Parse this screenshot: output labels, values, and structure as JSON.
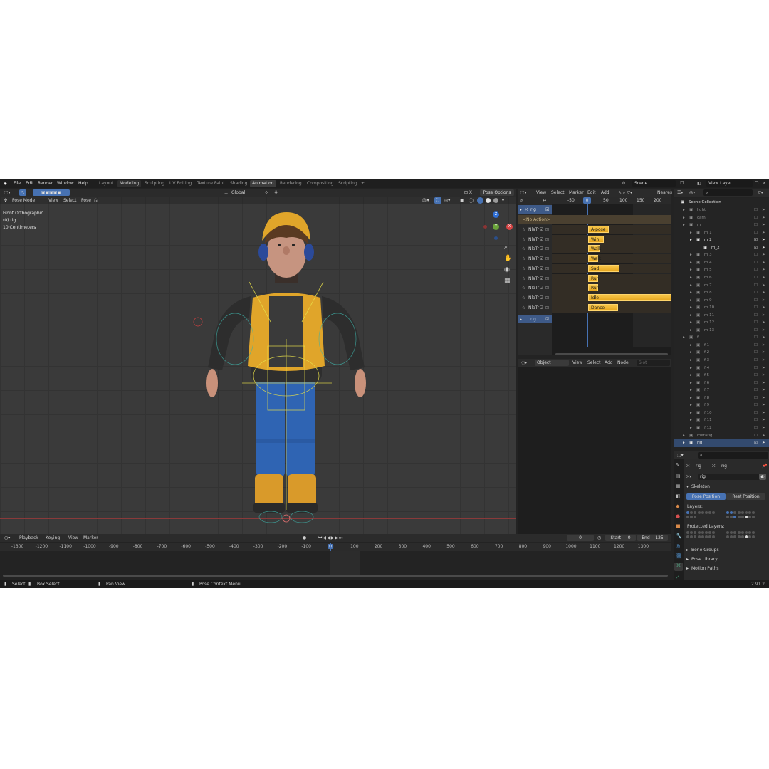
{
  "menu": [
    "File",
    "Edit",
    "Render",
    "Window",
    "Help"
  ],
  "workspaces": [
    {
      "label": "Layout",
      "active": false
    },
    {
      "label": "Modeling",
      "active": false
    },
    {
      "label": "Sculpting",
      "active": false
    },
    {
      "label": "UV Editing",
      "active": false
    },
    {
      "label": "Texture Paint",
      "active": false
    },
    {
      "label": "Shading",
      "active": false
    },
    {
      "label": "Animation",
      "active": true
    },
    {
      "label": "Rendering",
      "active": false
    },
    {
      "label": "Compositing",
      "active": false
    },
    {
      "label": "Scripting",
      "active": false
    }
  ],
  "add_tab": "+",
  "scene_label": "Scene",
  "view_layer_label": "View Layer",
  "viewport": {
    "mode": "Pose Mode",
    "menus": [
      "View",
      "Select",
      "Pose"
    ],
    "orientation": "Global",
    "pose_options": "Pose Options",
    "info": [
      "Front Orthographic",
      "(0) rig",
      "10 Centimeters"
    ],
    "gizmo": {
      "z": "Z",
      "y": "Y",
      "x": "X"
    }
  },
  "nla": {
    "menus": [
      "View",
      "Select",
      "Marker",
      "Edit",
      "Add"
    ],
    "snap": "Neares",
    "ruler": [
      "-50",
      "0",
      "50",
      "100",
      "150",
      "200"
    ],
    "object": "rig",
    "action": "<No Action>",
    "track_label": "NlaTr",
    "strips": [
      {
        "name": "A-pose",
        "width": 0.25
      },
      {
        "name": "Win",
        "width": 0.19
      },
      {
        "name": "Walk (f",
        "width": 0.14
      },
      {
        "name": "Walk",
        "width": 0.1
      },
      {
        "name": "Sad",
        "width": 0.38
      },
      {
        "name": "Run",
        "width": 0.08
      },
      {
        "name": "Run",
        "width": 0.08
      },
      {
        "name": "Idle",
        "width": 1.0
      },
      {
        "name": "Dance",
        "width": 0.36
      }
    ],
    "second_object": "rig"
  },
  "node": {
    "object_mode": "Object",
    "menus": [
      "View",
      "Select",
      "Add",
      "Node"
    ],
    "slot": "Slot"
  },
  "outliner": {
    "title": "Scene Collection",
    "rows": [
      {
        "label": "light",
        "bright": false,
        "indent": 1
      },
      {
        "label": "cam",
        "bright": false,
        "indent": 1
      },
      {
        "label": "m",
        "bright": false,
        "indent": 1
      },
      {
        "label": "m 1",
        "bright": false,
        "indent": 2
      },
      {
        "label": "m 2",
        "bright": true,
        "indent": 2
      },
      {
        "label": "m_2",
        "bright": true,
        "indent": 3
      },
      {
        "label": "m 3",
        "bright": false,
        "indent": 2
      },
      {
        "label": "m 4",
        "bright": false,
        "indent": 2
      },
      {
        "label": "m 5",
        "bright": false,
        "indent": 2
      },
      {
        "label": "m 6",
        "bright": false,
        "indent": 2
      },
      {
        "label": "m 7",
        "bright": false,
        "indent": 2
      },
      {
        "label": "m 8",
        "bright": false,
        "indent": 2
      },
      {
        "label": "m 9",
        "bright": false,
        "indent": 2
      },
      {
        "label": "m 10",
        "bright": false,
        "indent": 2
      },
      {
        "label": "m 11",
        "bright": false,
        "indent": 2
      },
      {
        "label": "m 12",
        "bright": false,
        "indent": 2
      },
      {
        "label": "m 13",
        "bright": false,
        "indent": 2
      },
      {
        "label": "f",
        "bright": false,
        "indent": 1
      },
      {
        "label": "f 1",
        "bright": false,
        "indent": 2
      },
      {
        "label": "f 2",
        "bright": false,
        "indent": 2
      },
      {
        "label": "f 3",
        "bright": false,
        "indent": 2
      },
      {
        "label": "f 4",
        "bright": false,
        "indent": 2
      },
      {
        "label": "f 5",
        "bright": false,
        "indent": 2
      },
      {
        "label": "f 6",
        "bright": false,
        "indent": 2
      },
      {
        "label": "f 7",
        "bright": false,
        "indent": 2
      },
      {
        "label": "f 8",
        "bright": false,
        "indent": 2
      },
      {
        "label": "f 9",
        "bright": false,
        "indent": 2
      },
      {
        "label": "f 10",
        "bright": false,
        "indent": 2
      },
      {
        "label": "f 11",
        "bright": false,
        "indent": 2
      },
      {
        "label": "f 12",
        "bright": false,
        "indent": 2
      },
      {
        "label": "metarig",
        "bright": false,
        "indent": 1
      },
      {
        "label": "rig",
        "bright": true,
        "indent": 1
      }
    ]
  },
  "properties": {
    "crumb_a": "rig",
    "crumb_b": "rig",
    "data_name": "rig",
    "section": "Skeleton",
    "pose_position": "Pose Position",
    "rest_position": "Rest Position",
    "layers": "Layers:",
    "protected_layers": "Protected Layers:",
    "collapsed": [
      "Bone Groups",
      "Pose Library",
      "Motion Paths"
    ]
  },
  "timeline": {
    "menus": [
      "Playback",
      "Keying",
      "View",
      "Marker"
    ],
    "current_frame": "0",
    "start_label": "Start",
    "start": "0",
    "end_label": "End",
    "end": "125",
    "ticks": [
      "-1300",
      "-1200",
      "-1100",
      "-1000",
      "-900",
      "-800",
      "-700",
      "-600",
      "-500",
      "-400",
      "-300",
      "-200",
      "-100",
      "0",
      "100",
      "200",
      "300",
      "400",
      "500",
      "600",
      "700",
      "800",
      "900",
      "1000",
      "1100",
      "1200",
      "1300"
    ]
  },
  "status": {
    "items": [
      "Select",
      "Box Select",
      "Pan View",
      "Pose Context Menu"
    ],
    "version": "2.91.2"
  },
  "colors": {
    "accent": "#4772b3",
    "strip": "#f0b530",
    "bg": "#232323"
  }
}
